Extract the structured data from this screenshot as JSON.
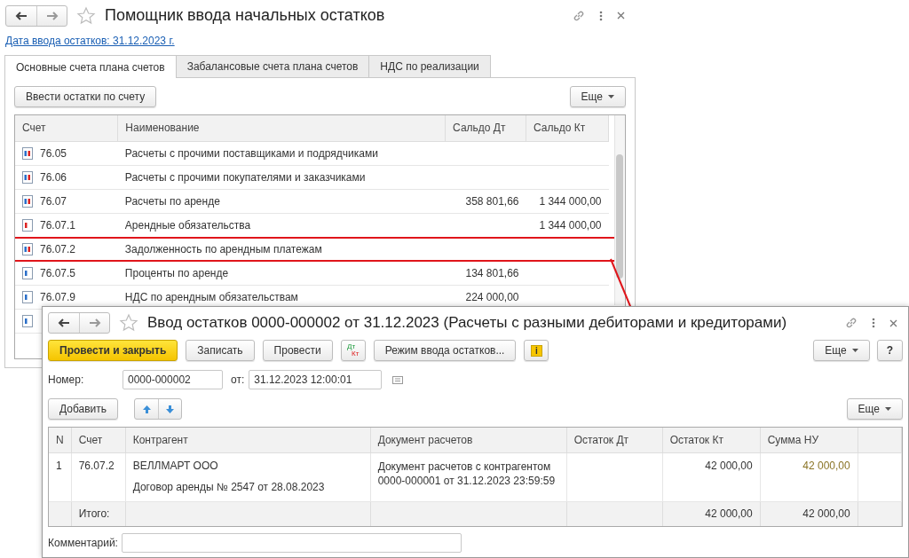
{
  "back_window": {
    "title": "Помощник ввода начальных остатков",
    "date_link": "Дата ввода остатков: 31.12.2023 г.",
    "tabs": [
      {
        "label": "Основные счета плана счетов",
        "selected": true
      },
      {
        "label": "Забалансовые счета плана счетов",
        "selected": false
      },
      {
        "label": "НДС по реализации",
        "selected": false
      }
    ],
    "enter_button": "Ввести остатки по счету",
    "more_button": "Еще",
    "table": {
      "columns": [
        "Счет",
        "Наименование",
        "Сальдо Дт",
        "Сальдо Кт"
      ],
      "rows": [
        {
          "account": "76.05",
          "kind": "active_passive",
          "name": "Расчеты с прочими поставщиками и подрядчиками",
          "highlighted": false
        },
        {
          "account": "76.06",
          "kind": "active_passive",
          "name": "Расчеты с прочими покупателями и заказчиками",
          "highlighted": false
        },
        {
          "account": "76.07",
          "kind": "active_passive",
          "name": "Расчеты по аренде",
          "debit": "358 801,66",
          "credit": "1 344 000,00",
          "highlighted": false
        },
        {
          "account": "76.07.1",
          "kind": "passive",
          "name": "Арендные обязательства",
          "credit": "1 344 000,00",
          "highlighted": false
        },
        {
          "account": "76.07.2",
          "kind": "active_passive",
          "name": "Задолженность по арендным платежам",
          "highlighted": true
        },
        {
          "account": "76.07.5",
          "kind": "active",
          "name": "Проценты по аренде",
          "debit": "134 801,66",
          "highlighted": false
        },
        {
          "account": "76.07.9",
          "kind": "active",
          "name": "НДС по арендным обязательствам",
          "debit": "224 000,00",
          "highlighted": false
        },
        {
          "kind": "active",
          "highlighted": false
        }
      ]
    }
  },
  "front_window": {
    "title": "Ввод остатков 0000-000002 от 31.12.2023 (Расчеты с разными дебиторами и кредиторами)",
    "toolbar": [
      {
        "kind": "primary",
        "label": "Провести и закрыть"
      },
      {
        "kind": "normal",
        "label": "Записать"
      },
      {
        "kind": "normal",
        "label": "Провести"
      },
      {
        "kind": "dtkt",
        "top": "Дт",
        "bottom": "Кт"
      },
      {
        "kind": "normal",
        "label": "Режим ввода остатков..."
      },
      {
        "kind": "info",
        "label": "i"
      }
    ],
    "more_button": "Еще",
    "help_button": "?",
    "number_label": "Номер:",
    "number": "0000-000002",
    "date_label": "от:",
    "date": "31.12.2023 12:00:01",
    "add_button": "Добавить",
    "table_more_button": "Еще",
    "table": {
      "columns": [
        "N",
        "Счет",
        "Контрагент",
        "Документ расчетов",
        "Остаток Дт",
        "Остаток Кт",
        "Сумма НУ"
      ],
      "rows": [
        {
          "n": "1",
          "account": "76.07.2",
          "counterparty": "ВЕЛЛМАРТ ООО",
          "contract": "Договор аренды № 2547 от 28.08.2023",
          "document_lines": [
            "Документ расчетов с контрагентом",
            "0000-000001 от 31.12.2023 23:59:59"
          ],
          "credit": "42 000,00",
          "tax_sum": "42 000,00"
        }
      ],
      "footer": {
        "label": "Итого:",
        "credit": "42 000,00",
        "tax_sum": "42 000,00"
      }
    },
    "comment_label": "Комментарий:"
  }
}
